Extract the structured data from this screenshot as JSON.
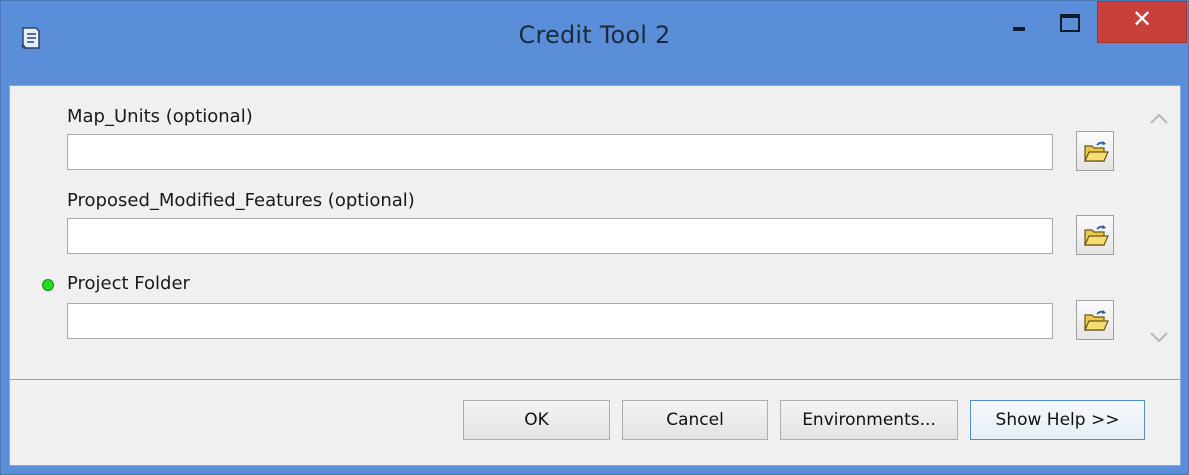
{
  "window": {
    "title": "Credit Tool 2",
    "icons": {
      "app": "tool-script-icon",
      "minimize": "minimize-icon",
      "maximize": "maximize-icon",
      "close": "close-icon"
    },
    "close_glyph": "✕",
    "accent_color": "#5b8ed8",
    "close_color": "#c7413a"
  },
  "params": [
    {
      "label": "Map_Units (optional)",
      "value": "",
      "required": false
    },
    {
      "label": "Proposed_Modified_Features (optional)",
      "value": "",
      "required": false
    },
    {
      "label": "Project Folder",
      "value": "",
      "required": true,
      "required_indicator_color": "#22dd22"
    }
  ],
  "scrollbar": {
    "up_icon": "chevron-up-icon",
    "down_icon": "chevron-down-icon"
  },
  "buttons": {
    "ok": "OK",
    "cancel": "Cancel",
    "environments": "Environments...",
    "show_help": "Show Help >>"
  }
}
